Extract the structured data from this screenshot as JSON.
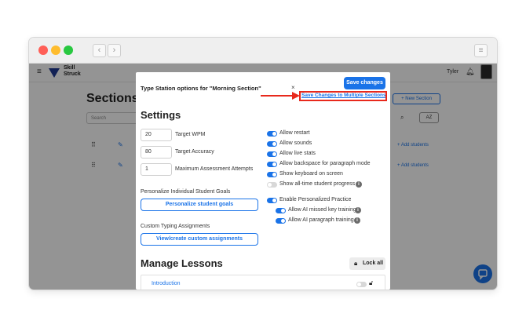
{
  "browser": {
    "window_controls": [
      "close",
      "minimize",
      "maximize"
    ],
    "menu_icon": "hamburger-icon"
  },
  "app": {
    "logo_line1": "Skill",
    "logo_line2": "Struck",
    "user_name": "Tyler",
    "page_title": "Sections",
    "search_placeholder": "Search",
    "new_section_label": "+ New Section",
    "sort_label": "AZ",
    "add_students_label": "+ Add students"
  },
  "modal": {
    "title": "Type Station options for \"Morning Section\"",
    "close_label": "×",
    "save_changes_label": "Save changes",
    "save_multiple_label": "Save Changes to Multiple Sections",
    "settings_heading": "Settings",
    "fields": [
      {
        "value": "20",
        "label": "Target WPM"
      },
      {
        "value": "80",
        "label": "Target Accuracy"
      },
      {
        "value": "1",
        "label": "Maximum Assessment Attempts"
      }
    ],
    "toggles": [
      {
        "label": "Allow restart",
        "on": true
      },
      {
        "label": "Allow sounds",
        "on": true
      },
      {
        "label": "Allow live stats",
        "on": true
      },
      {
        "label": "Allow backspace for paragraph mode",
        "on": true
      },
      {
        "label": "Show keyboard on screen",
        "on": true
      },
      {
        "label": "Show all-time student progress",
        "on": false
      }
    ],
    "personalize_heading": "Personalize Individual Student Goals",
    "personalize_button": "Personalize student goals",
    "custom_heading": "Custom Typing Assignments",
    "custom_button": "View/create custom assignments",
    "enable_practice_label": "Enable Personalized Practice",
    "ai_missed_label": "Allow AI missed key training",
    "ai_paragraph_label": "Allow AI paragraph training",
    "manage_heading": "Manage Lessons",
    "lock_all_label": "Lock all",
    "lesson_intro": "Introduction"
  },
  "colors": {
    "primary": "#1a73e8",
    "highlight": "#e8291c",
    "overlay": "#000000"
  }
}
